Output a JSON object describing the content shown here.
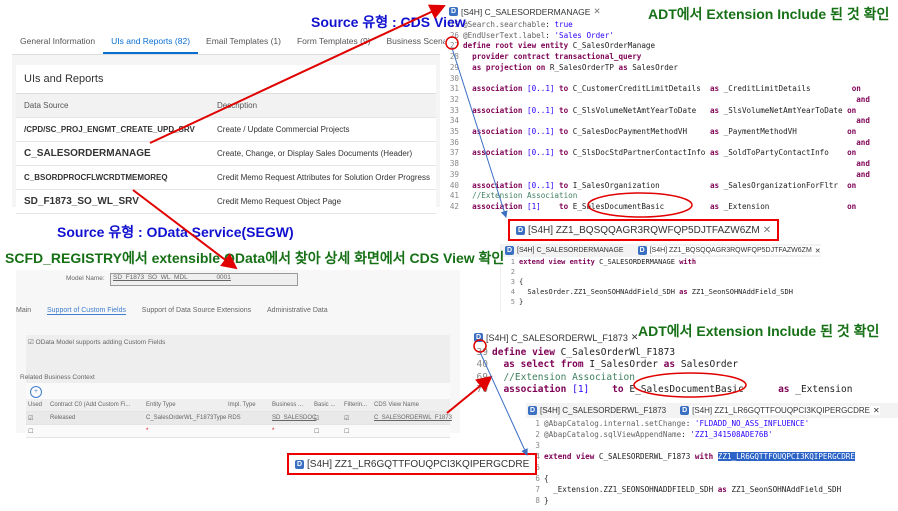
{
  "notes": {
    "cds_source": "Source   유형 : CDS View",
    "adt_check_1": "ADT에서 Extension Include 된 것 확인",
    "odata_source": "Source   유형 : OData Service(SEGW)",
    "scfd_note": "SCFD_REGISTRY에서 extensible OData에서 찾아 상세 화면에서 CDS View 확인",
    "adt_check_2": "ADT에서 Extension Include 된 것 확인"
  },
  "fiori": {
    "tabs": [
      {
        "label": "General Information"
      },
      {
        "label": "UIs and Reports (82)",
        "active": true
      },
      {
        "label": "Email Templates (1)"
      },
      {
        "label": "Form Templates (9)"
      },
      {
        "label": "Business Scenar"
      }
    ],
    "section_title": "UIs and Reports",
    "columns": [
      "Data Source",
      "Description"
    ],
    "rows": [
      {
        "source": "/CPD/SC_PROJ_ENGMT_CREATE_UPD_SRV",
        "description": "Create / Update Commercial Projects"
      },
      {
        "source": "C_SALESORDERMANAGE",
        "description": "Create, Change, or Display Sales Documents (Header)"
      },
      {
        "source": "C_BSORDPROCFLWCRDTMEMOREQ",
        "description": "Credit Memo Request Attributes for Solution Order Progress"
      },
      {
        "source": "SD_F1873_SO_WL_SRV",
        "description": "Credit Memo Request Object Page"
      }
    ]
  },
  "adt1": {
    "tab": "[S4H] C_SALESORDERMANAGE",
    "lines": [
      {
        "n": "25",
        "t": "@Search.searchable: true"
      },
      {
        "n": "26",
        "t": "@EndUserText.label: 'Sales Order'"
      },
      {
        "n": "27",
        "t": "define root view entity C_SalesOrderManage"
      },
      {
        "n": "28",
        "t": "  provider contract transactional_query"
      },
      {
        "n": "29",
        "t": "  as projection on R_SalesOrderTP as SalesOrder"
      },
      {
        "n": "30",
        "t": ""
      },
      {
        "n": "31",
        "t": "  association [0..1] to C_CustomerCreditLimitDetails  as _CreditLimitDetails         on"
      },
      {
        "n": "32",
        "t": "                                                                                      and"
      },
      {
        "n": "33",
        "t": "  association [0..1] to C_SlsVolumeNetAmtYearToDate   as _SlsVolumeNetAmtYearToDate on"
      },
      {
        "n": "34",
        "t": "                                                                                      and"
      },
      {
        "n": "35",
        "t": "  association [0..1] to C_SalesDocPaymentMethodVH     as _PaymentMethodVH           on"
      },
      {
        "n": "36",
        "t": "                                                                                      and"
      },
      {
        "n": "37",
        "t": "  association [0..1] to C_SlsDocStdPartnerContactInfo as _SoldToPartyContactInfo    on"
      },
      {
        "n": "38",
        "t": "                                                                                      and"
      },
      {
        "n": "39",
        "t": "                                                                                      and"
      },
      {
        "n": "40",
        "t": "  association [0..1] to I_SalesOrganization           as _SalesOrganizationForFltr  on"
      },
      {
        "n": "41",
        "t": "  //Extension Association"
      },
      {
        "n": "42",
        "t": "  association [1]    to E_SalesDocumentBasic          as _Extension                 on"
      }
    ]
  },
  "ext1": {
    "highlight_tab": "[S4H] ZZ1_BQSQQAGR3RQWFQP5DJTFAZW6ZM",
    "tabs": [
      "[S4H] C_SALESORDERMANAGE",
      "[S4H] ZZ1_BQSQQAGR3RQWFQP5DJTFAZW6ZM"
    ],
    "lines": [
      {
        "n": "1",
        "t": "extend view entity C_SALESORDERMANAGE with"
      },
      {
        "n": "2",
        "t": ""
      },
      {
        "n": "3",
        "t": "{"
      },
      {
        "n": "4",
        "t": "  SalesOrder.ZZ1_SeonSOHNAddField_SDH as ZZ1_SeonSOHNAddField_SDH"
      },
      {
        "n": "5",
        "t": "}"
      }
    ]
  },
  "scfd": {
    "model_label": "Model Name:",
    "model_value": "SD_F1873_SO_WL_MDL                0001",
    "tabs": [
      {
        "label": "Main"
      },
      {
        "label": "Support of Custom Fields",
        "active": true
      },
      {
        "label": "Support of Data Source Extensions"
      },
      {
        "label": "Administrative Data"
      }
    ],
    "checkbox_label": "OData Model supports adding Custom Fields",
    "section": "Related Business Context",
    "columns": [
      "Used",
      "Contract C0 (Add Custom Fi...",
      "Entity Type",
      "Impl. Type",
      "Business ...",
      "Basic ...",
      "Filterin...",
      "CDS View Name"
    ],
    "row1": {
      "contract": "Released",
      "entity": "C_SalesOrderWL_F1873Type",
      "impl": "RDS",
      "business": "SD_SALESDOC",
      "cds": "C_SALESORDERWL_F1873"
    },
    "required_mark": "*"
  },
  "adt2": {
    "tab": "[S4H] C_SALESORDERWL_F1873",
    "lines": [
      {
        "n": "39",
        "t": "define view C_SalesOrderWl_F1873"
      },
      {
        "n": "40",
        "t": "  as select from I_SalesOrder as SalesOrder"
      },
      {
        "n": "69",
        "t": "  //Extension Association"
      },
      {
        "n": "70",
        "t": "  association [1]    to E_SalesDocumentBasic      as _Extension"
      }
    ]
  },
  "ext2": {
    "highlight_tab": "[S4H] ZZ1_LR6GQTTFOUQPCI3KQIPERGCDRE",
    "tabs": [
      "[S4H] C_SALESORDERWL_F1873",
      "[S4H] ZZ1_LR6GQTTFOUQPCI3KQIPERGCDRE"
    ],
    "lines": [
      {
        "n": "1",
        "t": "@AbapCatalog.internal.setChange: 'FLDADD_NO_ASS_INFLUENCE'"
      },
      {
        "n": "2",
        "t": "@AbapCatalog.sqlViewAppendName: 'ZZ1_341508ADE76B'"
      },
      {
        "n": "3",
        "t": ""
      },
      {
        "n": "4",
        "t": "extend view C_SALESORDERWL_F1873 with "
      },
      {
        "n": "5",
        "t": ""
      },
      {
        "n": "6",
        "t": "{"
      },
      {
        "n": "7",
        "t": "  _Extension.ZZ1_SEONSOHNADDFIELD_SDH as ZZ1_SeonSOHNAddField_SDH"
      },
      {
        "n": "8",
        "t": "}"
      }
    ],
    "selected_text": "ZZ1_LR6GQTTFOUQPCI3KQIPERGCDRE"
  },
  "colors": {
    "annotation_red": "#e00000",
    "arrow_blue": "#3b6fc2",
    "note_blue": "#1010d0",
    "note_green": "#167016",
    "keyword": "#7f0055"
  }
}
